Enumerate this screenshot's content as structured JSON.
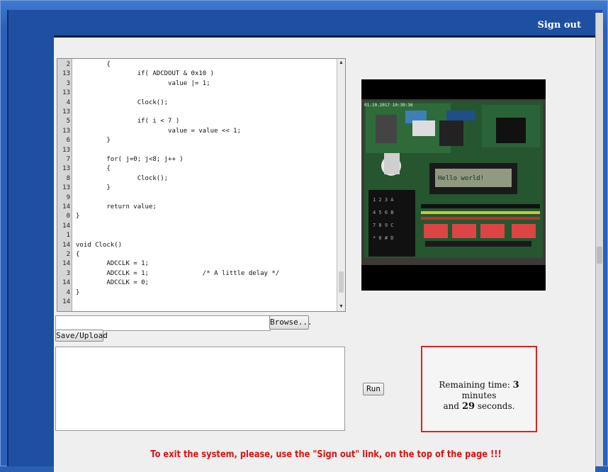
{
  "header": {
    "sign_out_label": "Sign out"
  },
  "editor": {
    "line_numbers": [
      "2",
      "13",
      "3",
      "13",
      "4",
      "13",
      "5",
      "13",
      "6",
      "13",
      "7",
      "13",
      "8",
      "13",
      "9",
      "14",
      "0",
      "14",
      "1",
      "14",
      "2",
      "14",
      "3",
      "14",
      "4",
      "14"
    ],
    "code_lines": [
      "        {",
      "                if( ADCDOUT & 0x10 )",
      "                        value |= 1;",
      "",
      "                Clock();",
      "",
      "                if( i < 7 )",
      "                        value = value << 1;",
      "        }",
      "",
      "        for( j=0; j<8; j++ )",
      "        {",
      "                Clock();",
      "        }",
      "",
      "        return value;",
      "}",
      "",
      "",
      "void Clock()",
      "{",
      "        ADCCLK = 1;",
      "        ADCCLK = 1;              /* A little delay */",
      "        ADCCLK = 0;",
      "}",
      ""
    ]
  },
  "upload": {
    "file_value": "",
    "browse_label": "Browse...",
    "save_label": "Save/Upload"
  },
  "output": {
    "text": ""
  },
  "run_label": "Run",
  "timer": {
    "prefix": "Remaining time:",
    "minutes": "3",
    "minutes_unit": "minutes",
    "and": "and",
    "seconds": "29",
    "seconds_unit": "seconds."
  },
  "notice": "To exit the system, please, use the \"Sign out\" link, on the top of the page !!!",
  "camera": {
    "lcd_text": "Hello world!",
    "overlay_text": "01.10.2017 10:39:36"
  }
}
